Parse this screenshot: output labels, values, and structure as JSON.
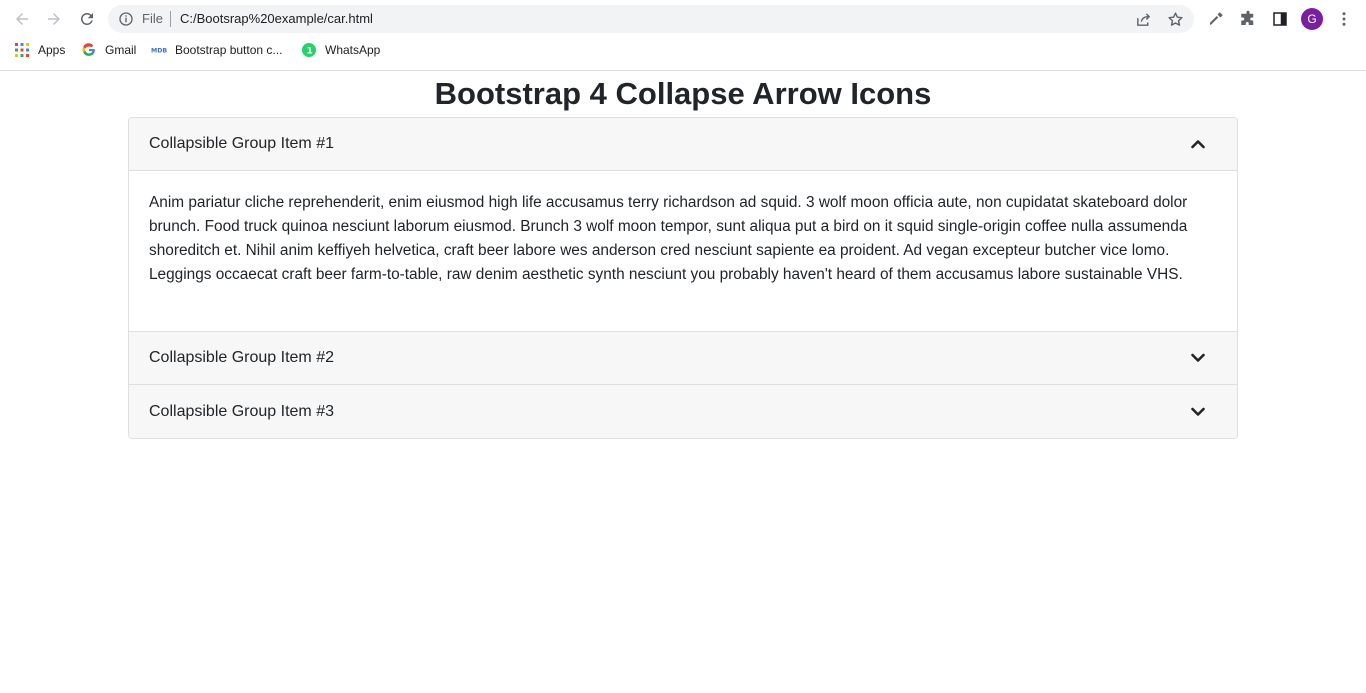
{
  "browser": {
    "omnibox": {
      "scheme_label": "File",
      "url": "C:/Bootsrap%20example/car.html"
    },
    "profile_initial": "G",
    "bookmarks": [
      {
        "label": "Apps",
        "icon": "apps-grid-icon"
      },
      {
        "label": "Gmail",
        "icon": "google-icon"
      },
      {
        "label": "Bootstrap button c...",
        "icon": "mdb-icon"
      },
      {
        "label": "WhatsApp",
        "icon": "whatsapp-icon"
      }
    ]
  },
  "page": {
    "title": "Bootstrap 4 Collapse Arrow Icons",
    "accordion": [
      {
        "title": "Collapsible Group Item #1",
        "expanded": true,
        "body": "Anim pariatur cliche reprehenderit, enim eiusmod high life accusamus terry richardson ad squid. 3 wolf moon officia aute, non cupidatat skateboard dolor brunch. Food truck quinoa nesciunt laborum eiusmod. Brunch 3 wolf moon tempor, sunt aliqua put a bird on it squid single-origin coffee nulla assumenda shoreditch et. Nihil anim keffiyeh helvetica, craft beer labore wes anderson cred nesciunt sapiente ea proident. Ad vegan excepteur butcher vice lomo. Leggings occaecat craft beer farm-to-table, raw denim aesthetic synth nesciunt you probably haven't heard of them accusamus labore sustainable VHS."
      },
      {
        "title": "Collapsible Group Item #2",
        "expanded": false
      },
      {
        "title": "Collapsible Group Item #3",
        "expanded": false
      }
    ]
  },
  "colors": {
    "avatar": "#7b1fa2",
    "header_bg": "#f7f7f7",
    "border": "#dfdfdf"
  }
}
